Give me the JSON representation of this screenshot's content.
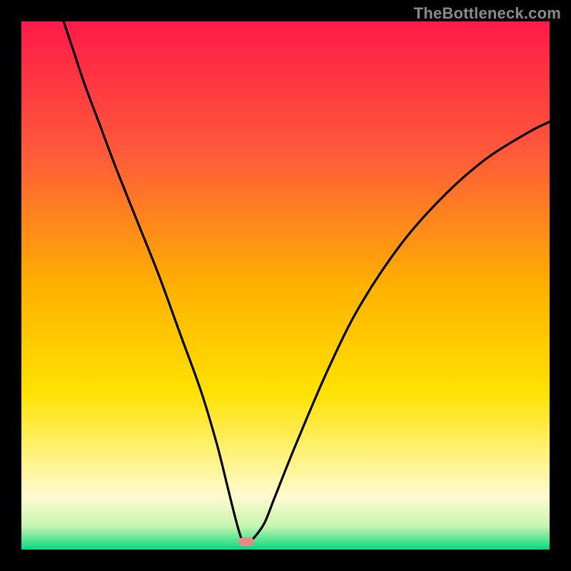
{
  "watermark": "TheBottleneck.com",
  "chart_data": {
    "type": "line",
    "title": "",
    "xlabel": "",
    "ylabel": "",
    "xlim": [
      0,
      100
    ],
    "ylim": [
      0,
      100
    ],
    "gradient_stops": [
      {
        "offset": 0,
        "color": "#ff1a49"
      },
      {
        "offset": 0.25,
        "color": "#ff5a3a"
      },
      {
        "offset": 0.5,
        "color": "#ffb000"
      },
      {
        "offset": 0.7,
        "color": "#ffe100"
      },
      {
        "offset": 0.82,
        "color": "#fff27a"
      },
      {
        "offset": 0.9,
        "color": "#fffad0"
      },
      {
        "offset": 0.955,
        "color": "#c8f5b0"
      },
      {
        "offset": 0.985,
        "color": "#48e290"
      },
      {
        "offset": 1.0,
        "color": "#00d885"
      }
    ],
    "series": [
      {
        "name": "bottleneck-curve",
        "x": [
          8,
          10,
          12,
          15,
          18,
          22,
          26,
          30,
          34,
          37,
          39,
          40.5,
          41.5,
          42,
          42.5,
          43.2,
          44,
          46,
          48,
          52,
          58,
          64,
          72,
          80,
          88,
          96,
          100
        ],
        "y": [
          100,
          94,
          88,
          80,
          72,
          62,
          52,
          41,
          30,
          20,
          12,
          6,
          2.5,
          1.6,
          1.5,
          1.6,
          2.2,
          5,
          10,
          20,
          34,
          46,
          58,
          67,
          74,
          79,
          81
        ]
      }
    ],
    "marker": {
      "x": 42.5,
      "y": 1.5,
      "color": "#e78b86"
    }
  }
}
